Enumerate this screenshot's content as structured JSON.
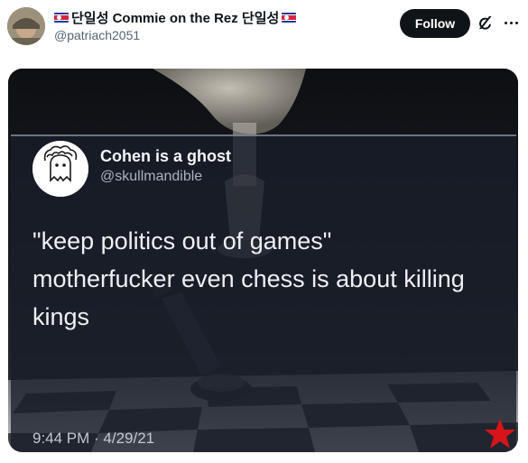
{
  "header": {
    "display_name": "단일성 Commie on the Rez 단일성",
    "handle": "@patriach2051",
    "follow_label": "Follow"
  },
  "card": {
    "name": "Cohen is a ghost",
    "handle": "@skullmandible",
    "text_lines": [
      "\"keep politics out of games\"",
      "motherfucker even chess is about killing",
      "kings"
    ],
    "timestamp": "9:44 PM · 4/29/21"
  },
  "icons": {
    "avatar": "user-avatar",
    "flag": "north-korea-flag-icon",
    "grok": "grok-icon",
    "more": "more-dots-icon",
    "card_avatar": "ghost-avatar-icon",
    "watermark": "red-star-icon"
  },
  "colors": {
    "follow_bg": "#0f1419",
    "follow_text": "#ffffff",
    "handle": "#536471",
    "watermark_star": "#d7141a"
  }
}
